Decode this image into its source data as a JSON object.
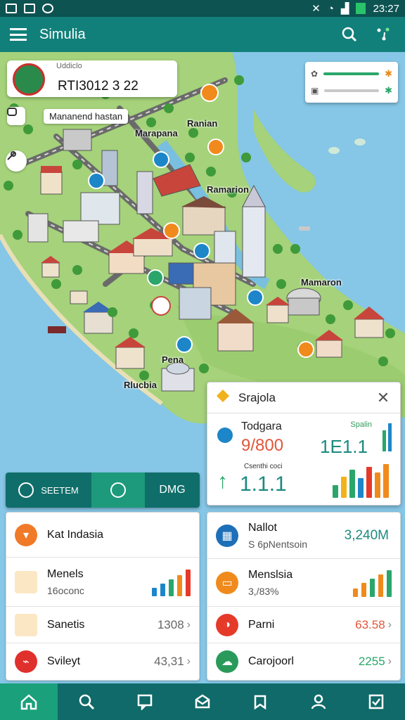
{
  "status_bar": {
    "time": "23:27"
  },
  "app_bar": {
    "title": "Simulia",
    "search_icon": "search-icon",
    "menu_icon": "menu-icon",
    "share_icon": "share-icon"
  },
  "map": {
    "location_card": {
      "subtitle": "Uddiclo",
      "title": "RTI3012 3 22"
    },
    "chip_label": "Mananend hastan",
    "place_labels": [
      "Marapana",
      "Ranian",
      "Ramarion",
      "Mamaron",
      "Pena",
      "Rlucbia"
    ],
    "legend": {
      "color_primary": "#2aa66a",
      "color_secondary": "#e68a1c"
    },
    "water_color": "#86c6e6",
    "land_color": "#a5d27a"
  },
  "popup": {
    "title": "Srajola",
    "today_label": "Todgara",
    "today_value": "9/800",
    "spark_label": "Spalin",
    "spark_value": "1E1.1",
    "chart_caption": "Csenthi coci",
    "trend_value": "1.1.1"
  },
  "segment": {
    "left_label": "SEETEM",
    "right_label": "DMG"
  },
  "list_left": [
    {
      "title": "Kat Indasia",
      "subtitle": "",
      "value": "",
      "icon": "chat-icon",
      "color": "#f07a28"
    },
    {
      "title": "Menels",
      "subtitle": "16oconc",
      "value": "",
      "icon": "notepad-icon",
      "color": "#f0a020"
    },
    {
      "title": "Sanetis",
      "subtitle": "",
      "value": "1308",
      "icon": "document-icon",
      "color": "#f0a020"
    },
    {
      "title": "Svileyt",
      "subtitle": "",
      "value": "43,31",
      "icon": "tool-icon",
      "color": "#e0302c"
    }
  ],
  "list_right": [
    {
      "title": "Nallot",
      "subtitle": "S 6pNentsoin",
      "value": "3,240M",
      "icon": "calendar-icon",
      "color": "#1d6fb8"
    },
    {
      "title": "Menslsia",
      "subtitle": "3,/83%",
      "value": "",
      "icon": "wallet-icon",
      "color": "#f08a1c"
    },
    {
      "title": "Parni",
      "subtitle": "",
      "value": "63.58",
      "icon": "chart-icon",
      "color": "#e53a2a"
    },
    {
      "title": "Carojoorl",
      "subtitle": "",
      "value": "2255",
      "icon": "cloud-icon",
      "color": "#2a9a5a"
    }
  ],
  "bottom_nav": [
    "home-icon",
    "search-icon",
    "chat-icon",
    "mail-icon",
    "bookmark-icon",
    "profile-icon",
    "check-icon"
  ]
}
